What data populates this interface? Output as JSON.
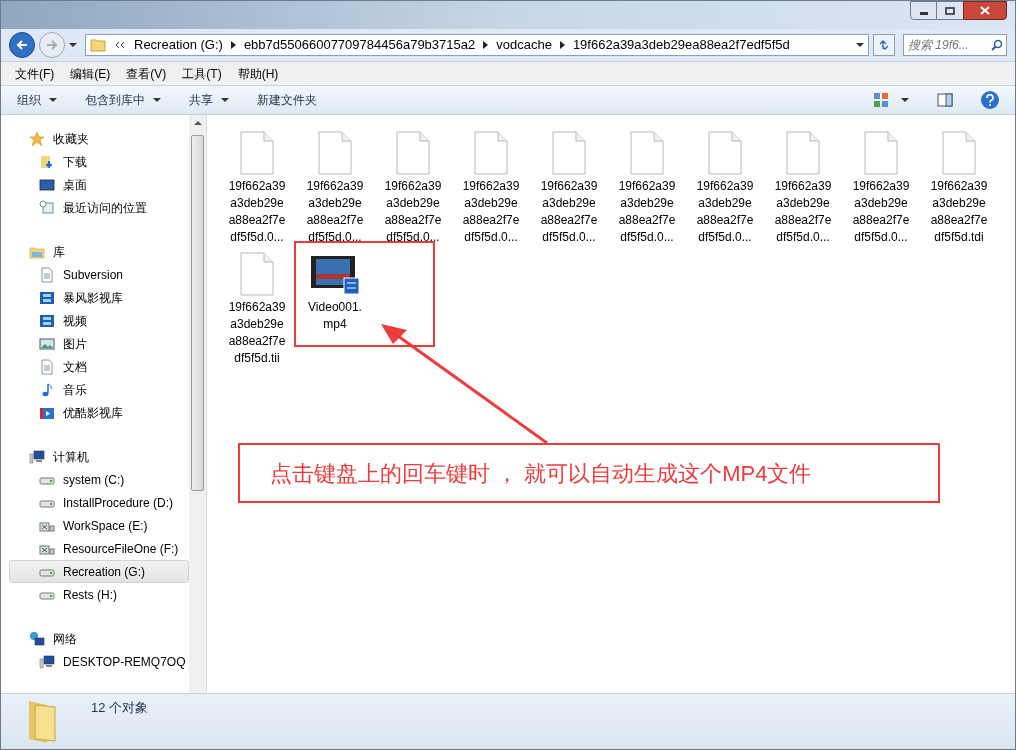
{
  "address": {
    "segments": [
      "Recreation (G:)",
      "ebb7d55066007709784456a79b3715a2",
      "vodcache",
      "19f662a39a3deb29ea88ea2f7edf5f5d"
    ]
  },
  "search": {
    "placeholder": "搜索 19f6..."
  },
  "menu": [
    "文件(F)",
    "编辑(E)",
    "查看(V)",
    "工具(T)",
    "帮助(H)"
  ],
  "toolbar": [
    {
      "label": "组织",
      "dropdown": true
    },
    {
      "label": "包含到库中",
      "dropdown": true
    },
    {
      "label": "共享",
      "dropdown": true
    },
    {
      "label": "新建文件夹",
      "dropdown": false
    }
  ],
  "sidebar": [
    {
      "label": "收藏夹",
      "kind": "star",
      "children": [
        {
          "label": "下载",
          "kind": "download",
          "selected": false
        },
        {
          "label": "桌面",
          "kind": "desktop",
          "selected": false
        },
        {
          "label": "最近访问的位置",
          "kind": "recent",
          "selected": false
        }
      ]
    },
    {
      "label": "库",
      "kind": "library",
      "children": [
        {
          "label": "Subversion",
          "kind": "doc",
          "selected": false
        },
        {
          "label": "暴风影视库",
          "kind": "film",
          "selected": false
        },
        {
          "label": "视频",
          "kind": "film",
          "selected": false
        },
        {
          "label": "图片",
          "kind": "picture",
          "selected": false
        },
        {
          "label": "文档",
          "kind": "doc",
          "selected": false
        },
        {
          "label": "音乐",
          "kind": "music",
          "selected": false
        },
        {
          "label": "优酷影视库",
          "kind": "play",
          "selected": false
        }
      ]
    },
    {
      "label": "计算机",
      "kind": "computer",
      "children": [
        {
          "label": "system (C:)",
          "kind": "drive",
          "selected": false
        },
        {
          "label": "InstallProcedure (D:)",
          "kind": "drive",
          "selected": false
        },
        {
          "label": "WorkSpace (E:)",
          "kind": "netdrive",
          "selected": false
        },
        {
          "label": "ResourceFileOne (F:)",
          "kind": "netdrive",
          "selected": false
        },
        {
          "label": "Recreation (G:)",
          "kind": "drive",
          "selected": true
        },
        {
          "label": "Rests (H:)",
          "kind": "drive",
          "selected": false
        }
      ]
    },
    {
      "label": "网络",
      "kind": "network",
      "children": [
        {
          "label": "DESKTOP-REMQ7OQ",
          "kind": "computer",
          "selected": false
        }
      ]
    }
  ],
  "files": [
    {
      "kind": "file",
      "lines": [
        "19f662a39",
        "a3deb29e",
        "a88ea2f7e",
        "df5f5d.0..."
      ]
    },
    {
      "kind": "file",
      "lines": [
        "19f662a39",
        "a3deb29e",
        "a88ea2f7e",
        "df5f5d.0..."
      ]
    },
    {
      "kind": "file",
      "lines": [
        "19f662a39",
        "a3deb29e",
        "a88ea2f7e",
        "df5f5d.0..."
      ]
    },
    {
      "kind": "file",
      "lines": [
        "19f662a39",
        "a3deb29e",
        "a88ea2f7e",
        "df5f5d.0..."
      ]
    },
    {
      "kind": "file",
      "lines": [
        "19f662a39",
        "a3deb29e",
        "a88ea2f7e",
        "df5f5d.0..."
      ]
    },
    {
      "kind": "file",
      "lines": [
        "19f662a39",
        "a3deb29e",
        "a88ea2f7e",
        "df5f5d.0..."
      ]
    },
    {
      "kind": "file",
      "lines": [
        "19f662a39",
        "a3deb29e",
        "a88ea2f7e",
        "df5f5d.0..."
      ]
    },
    {
      "kind": "file",
      "lines": [
        "19f662a39",
        "a3deb29e",
        "a88ea2f7e",
        "df5f5d.0..."
      ]
    },
    {
      "kind": "file",
      "lines": [
        "19f662a39",
        "a3deb29e",
        "a88ea2f7e",
        "df5f5d.0..."
      ]
    },
    {
      "kind": "file",
      "lines": [
        "19f662a39",
        "a3deb29e",
        "a88ea2f7e",
        "df5f5d.tdi"
      ]
    },
    {
      "kind": "file",
      "lines": [
        "19f662a39",
        "a3deb29e",
        "a88ea2f7e",
        "df5f5d.tii"
      ]
    },
    {
      "kind": "video",
      "lines": [
        "Video001.",
        "mp4"
      ]
    }
  ],
  "annotation": {
    "text": "点击键盘上的回车键时 ， 就可以自动生成这个MP4文件"
  },
  "status_bar": {
    "count": "12 个对象"
  }
}
